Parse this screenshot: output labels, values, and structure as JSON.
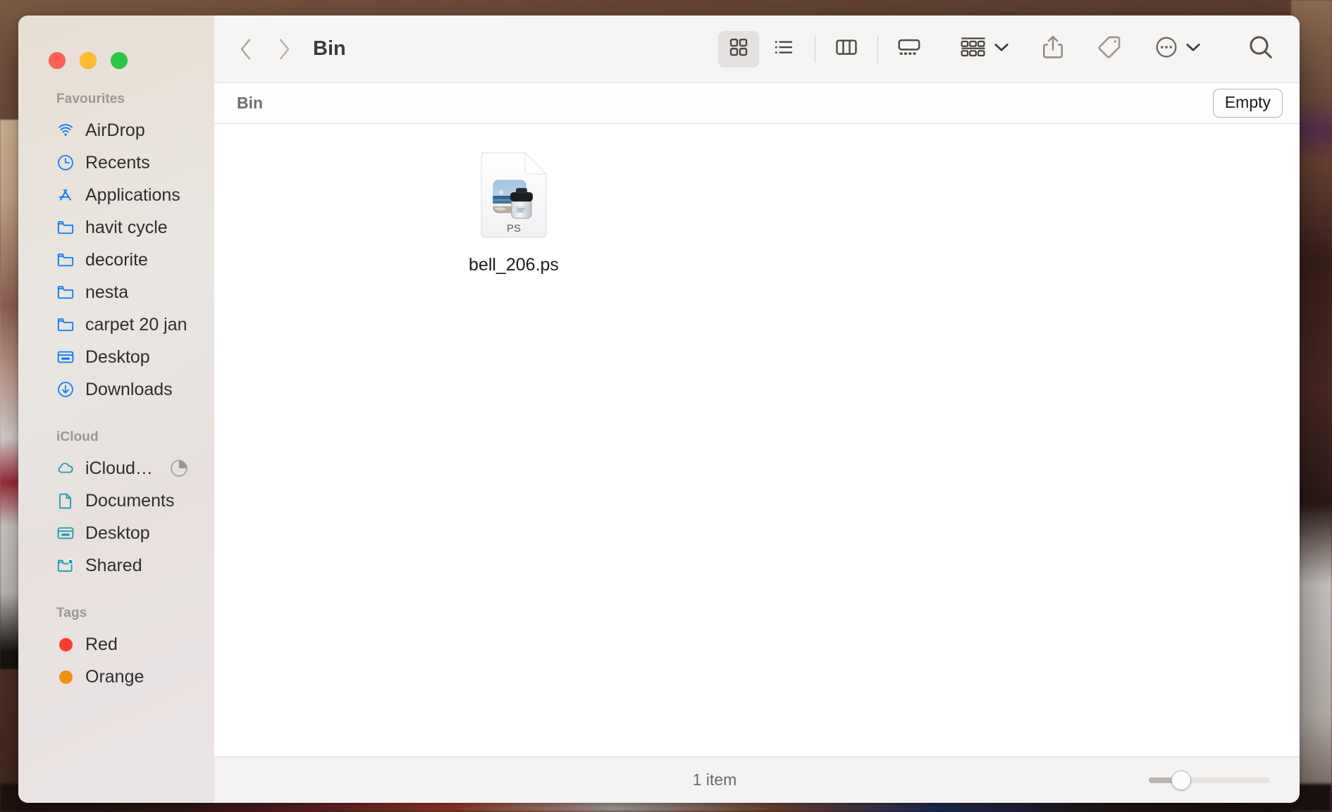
{
  "window": {
    "title": "Bin",
    "traffic_lights": [
      {
        "name": "close",
        "color": "#ff5f57"
      },
      {
        "name": "minimize",
        "color": "#febc2e"
      },
      {
        "name": "maximize",
        "color": "#28c840"
      }
    ]
  },
  "toolbar": {
    "back_icon": "chevron-left-icon",
    "forward_icon": "chevron-right-icon",
    "view_modes": [
      {
        "icon": "icon-view-icon",
        "label": "Icon View",
        "active": true
      },
      {
        "icon": "list-view-icon",
        "label": "List View",
        "active": false
      },
      {
        "icon": "column-view-icon",
        "label": "Column View",
        "active": false
      },
      {
        "icon": "gallery-view-icon",
        "label": "Gallery View",
        "active": false
      }
    ],
    "group_icon": "group-by-icon",
    "share_icon": "share-icon",
    "tag_icon": "tag-icon",
    "more_icon": "more-ellipsis-icon",
    "search_icon": "search-icon"
  },
  "pathbar": {
    "title": "Bin",
    "empty_button": "Empty"
  },
  "sidebar": {
    "sections": [
      {
        "title": "Favourites",
        "items": [
          {
            "label": "AirDrop",
            "icon": "airdrop-icon",
            "color": "#0a7cf5"
          },
          {
            "label": "Recents",
            "icon": "clock-icon",
            "color": "#0a7cf5"
          },
          {
            "label": "Applications",
            "icon": "applications-icon",
            "color": "#0a7cf5"
          },
          {
            "label": "havit cycle",
            "icon": "folder-icon",
            "color": "#0a7cf5"
          },
          {
            "label": "decorite",
            "icon": "folder-icon",
            "color": "#0a7cf5"
          },
          {
            "label": "nesta",
            "icon": "folder-icon",
            "color": "#0a7cf5"
          },
          {
            "label": "carpet 20 jan",
            "icon": "folder-icon",
            "color": "#0a7cf5"
          },
          {
            "label": "Desktop",
            "icon": "desktop-icon",
            "color": "#0a7cf5"
          },
          {
            "label": "Downloads",
            "icon": "download-icon",
            "color": "#0a7cf5"
          }
        ]
      },
      {
        "title": "iCloud",
        "items": [
          {
            "label": "iCloud…",
            "icon": "cloud-icon",
            "color": "#1f9bb3",
            "trailing": "sync-progress-icon"
          },
          {
            "label": "Documents",
            "icon": "document-icon",
            "color": "#1f9bb3"
          },
          {
            "label": "Desktop",
            "icon": "desktop-icon",
            "color": "#1f9bb3"
          },
          {
            "label": "Shared",
            "icon": "shared-folder-icon",
            "color": "#1f9bb3"
          }
        ]
      },
      {
        "title": "Tags",
        "items": [
          {
            "label": "Red",
            "icon": "tag-dot-icon",
            "color": "#ff3b30"
          },
          {
            "label": "Orange",
            "icon": "tag-dot-icon",
            "color": "#f2900d"
          }
        ]
      }
    ]
  },
  "files": [
    {
      "name": "bell_206.ps",
      "icon": "postscript-file-icon",
      "badge": "PS"
    }
  ],
  "statusbar": {
    "item_count": "1 item",
    "zoom_value": 22
  }
}
